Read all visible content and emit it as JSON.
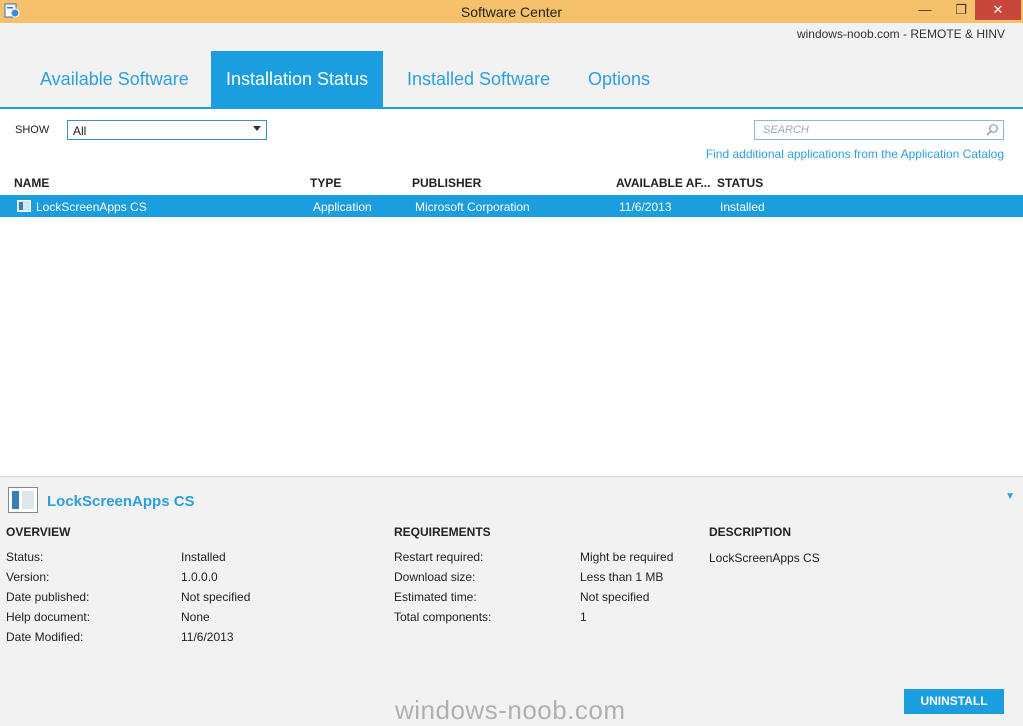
{
  "window": {
    "title": "Software Center",
    "subtitle": "windows-noob.com - REMOTE & HINV",
    "min_glyph": "—",
    "max_glyph": "❐",
    "close_glyph": "✕"
  },
  "tabs": [
    {
      "label": "Available Software"
    },
    {
      "label": "Installation Status"
    },
    {
      "label": "Installed Software"
    },
    {
      "label": "Options"
    }
  ],
  "filter": {
    "show_label": "SHOW",
    "show_value": "All",
    "search_placeholder": "SEARCH",
    "catalog_link": "Find additional applications from the Application Catalog"
  },
  "table": {
    "headers": {
      "name": "NAME",
      "type": "TYPE",
      "publisher": "PUBLISHER",
      "available": "AVAILABLE AF...",
      "status": "STATUS"
    },
    "rows": [
      {
        "name": "LockScreenApps CS",
        "type": "Application",
        "publisher": "Microsoft Corporation",
        "available": "11/6/2013",
        "status": "Installed"
      }
    ]
  },
  "details": {
    "title": "LockScreenApps CS",
    "overview": {
      "heading": "OVERVIEW",
      "items": [
        {
          "label": "Status:",
          "value": "Installed"
        },
        {
          "label": "Version:",
          "value": "1.0.0.0"
        },
        {
          "label": "Date published:",
          "value": "Not specified"
        },
        {
          "label": "Help document:",
          "value": "None"
        },
        {
          "label": "Date Modified:",
          "value": "11/6/2013"
        }
      ]
    },
    "requirements": {
      "heading": "REQUIREMENTS",
      "items": [
        {
          "label": "Restart required:",
          "value": "Might be required"
        },
        {
          "label": "Download size:",
          "value": "Less than 1 MB"
        },
        {
          "label": "Estimated time:",
          "value": "Not specified"
        },
        {
          "label": "Total components:",
          "value": "1"
        }
      ]
    },
    "description": {
      "heading": "DESCRIPTION",
      "text": "LockScreenApps CS"
    },
    "uninstall_label": "UNINSTALL"
  },
  "watermark": "windows-noob.com",
  "colors": {
    "titlebar": "#f5c26b",
    "accent": "#1a9ee0",
    "link": "#2ca0de",
    "close": "#c7473a"
  }
}
